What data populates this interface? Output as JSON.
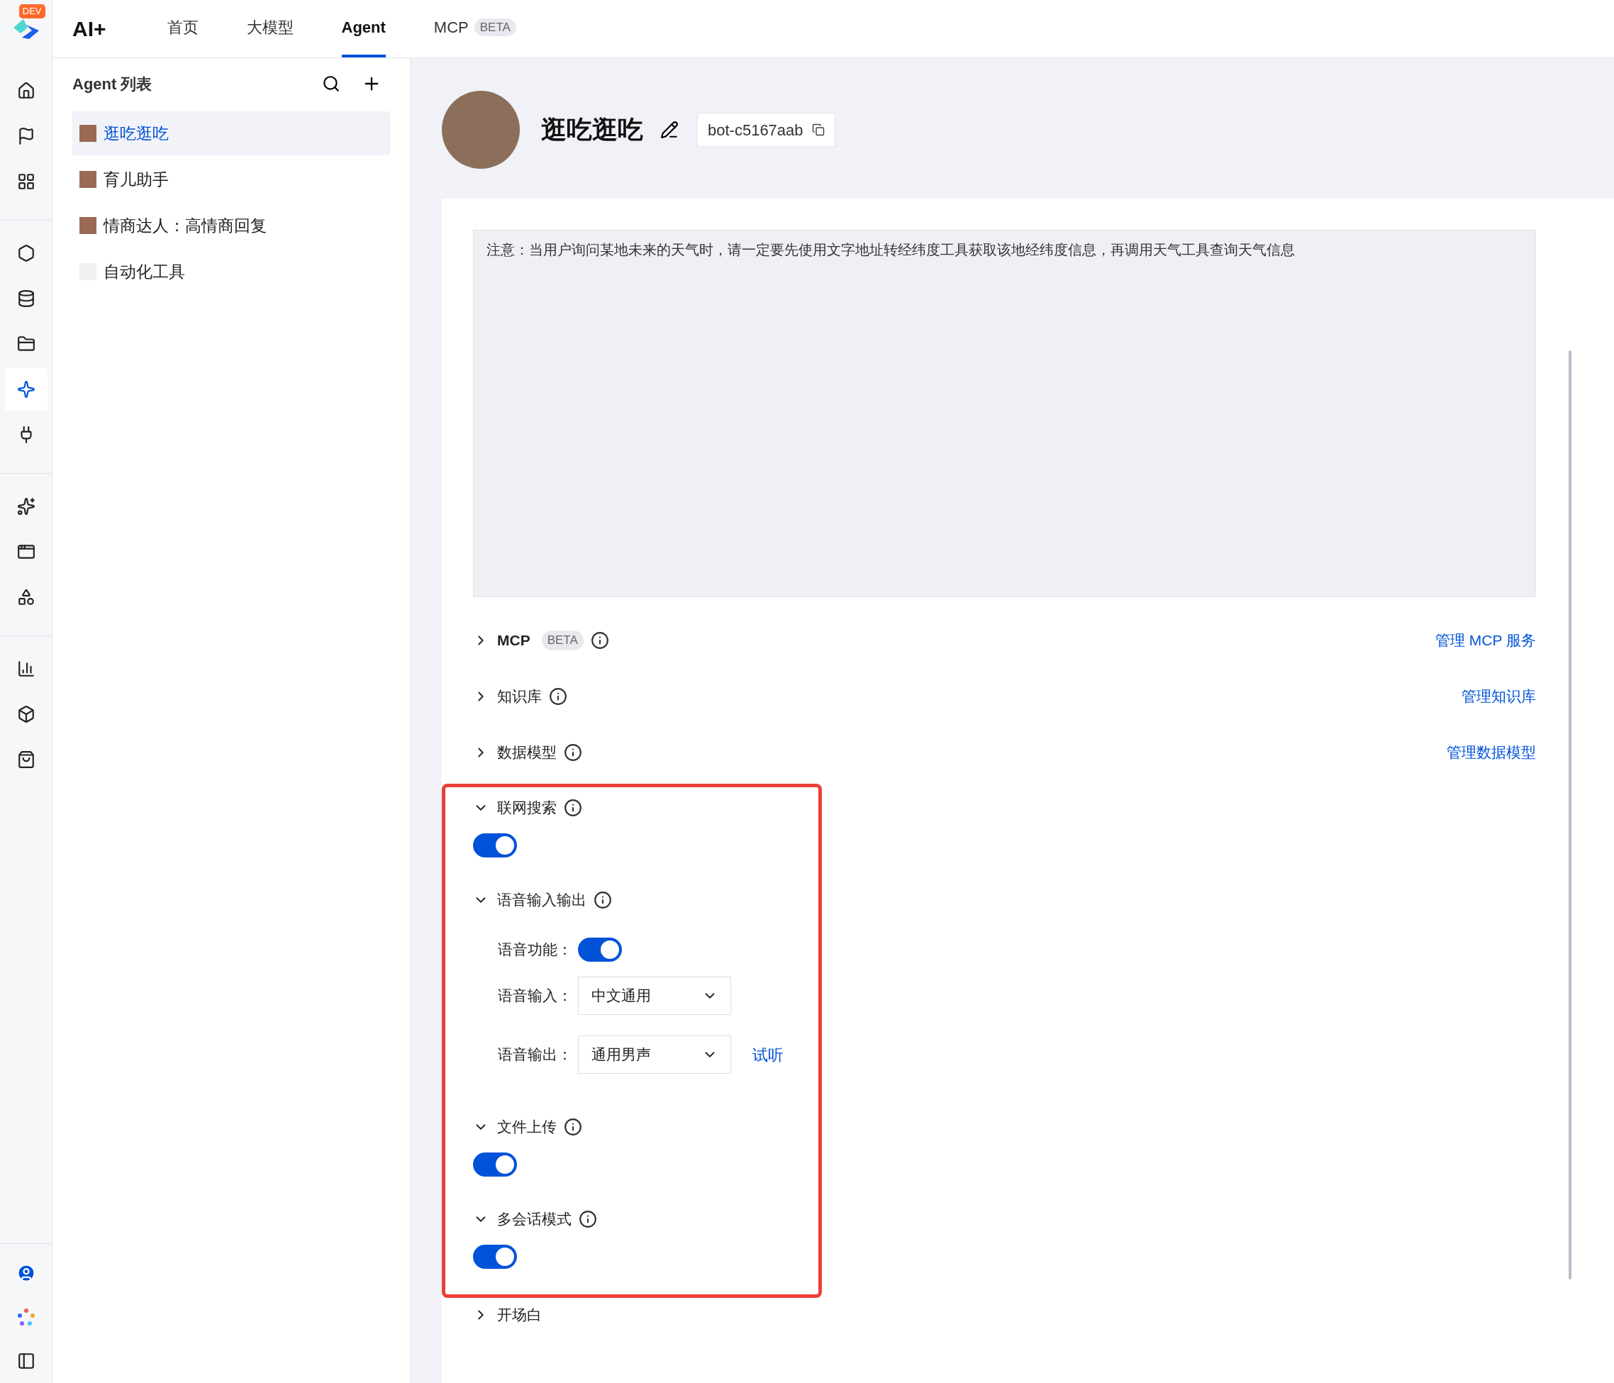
{
  "app": {
    "logo_badge": "DEV",
    "brand": "AI+"
  },
  "nav_tabs": [
    {
      "label": "首页",
      "selected": false
    },
    {
      "label": "大模型",
      "selected": false
    },
    {
      "label": "Agent",
      "selected": true
    },
    {
      "label": "MCP",
      "badge": "BETA",
      "selected": false
    }
  ],
  "rail_groups": [
    [
      {
        "selected": false
      },
      {
        "selected": false
      },
      {
        "selected": false
      }
    ],
    [
      {
        "selected": false
      },
      {
        "selected": false
      },
      {
        "selected": false
      },
      {
        "selected": true
      },
      {
        "selected": false
      }
    ],
    [
      {
        "selected": false
      },
      {
        "selected": false
      },
      {
        "selected": false
      }
    ],
    [
      {
        "selected": false
      },
      {
        "selected": false
      },
      {
        "selected": false
      }
    ]
  ],
  "agent_list": {
    "title": "Agent 列表",
    "items": [
      {
        "name": "逛吃逛吃",
        "selected": true
      },
      {
        "name": "育儿助手",
        "selected": false
      },
      {
        "name": "情商达人：高情商回复",
        "selected": false
      },
      {
        "name": "自动化工具",
        "selected": false
      }
    ]
  },
  "agent": {
    "name": "逛吃逛吃",
    "bot_id": "bot-c5167aab"
  },
  "prompt": {
    "value": "注意：当用户询问某地未来的天气时，请一定要先使用文字地址转经纬度工具获取该地经纬度信息，再调用天气工具查询天气信息"
  },
  "sections": [
    {
      "kind": "link",
      "title": "MCP",
      "badge": "BETA",
      "expanded": false,
      "link": "管理 MCP 服务"
    },
    {
      "kind": "link",
      "title": "知识库",
      "expanded": false,
      "link": "管理知识库"
    },
    {
      "kind": "link",
      "title": "数据模型",
      "expanded": false,
      "link": "管理数据模型"
    }
  ],
  "highlighted_sections": [
    {
      "kind": "toggle",
      "title": "联网搜索",
      "expanded": true,
      "on": true
    },
    {
      "kind": "voice",
      "title": "语音输入输出",
      "expanded": true,
      "feature_label": "语音功能：",
      "feature_on": true,
      "input_label": "语音输入：",
      "input_value": "中文通用",
      "output_label": "语音输出：",
      "output_value": "通用男声",
      "preview": "试听"
    },
    {
      "kind": "toggle",
      "title": "文件上传",
      "expanded": true,
      "on": true
    },
    {
      "kind": "toggle",
      "title": "多会话模式",
      "expanded": true,
      "on": true
    }
  ],
  "sections_after": [
    {
      "kind": "plain",
      "title": "开场白",
      "expanded": false
    }
  ]
}
